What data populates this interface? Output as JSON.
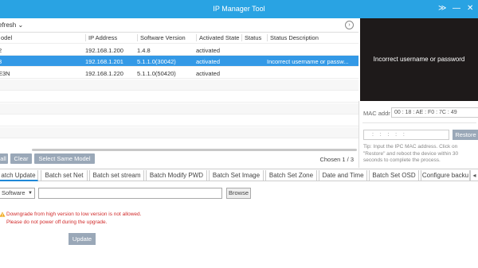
{
  "window": {
    "title": "IP Manager Tool",
    "controls": [
      "≫",
      "—",
      "✕"
    ]
  },
  "toolbar": {
    "refresh_label": "efresh ⌄",
    "toggle_icon": "›"
  },
  "table": {
    "headers": [
      "odel",
      "IP Address",
      "Software Version",
      "Activated State",
      "Status",
      "Status Description"
    ],
    "rows": [
      {
        "model": "2",
        "ip": "192.168.1.200",
        "version": "1.4.8",
        "state": "activated",
        "status": "",
        "desc": ""
      },
      {
        "model": "3",
        "ip": "192.168.1.201",
        "version": "5.1.1.0(30042)",
        "state": "activated",
        "status": "",
        "desc": "Incorrect username or passw..."
      },
      {
        "model": "E3N",
        "ip": "192.168.1.220",
        "version": "5.1.1.0(50420)",
        "state": "activated",
        "status": "",
        "desc": ""
      }
    ]
  },
  "actions": {
    "all_label": "all",
    "clear_label": "Clear",
    "select_same_label": "Select Same Model",
    "chosen": "Chosen 1 / 3"
  },
  "preview": {
    "message": "Incorrect username or password"
  },
  "mac": {
    "label": "MAC addr",
    "value": "00 : 18 : AE : F0 : 7C : 49"
  },
  "restore": {
    "input_value": ":    :    :    :    :",
    "button_label": "Restore",
    "tip": "Tip: Input the IPC MAC address. Click on \"Restore\" and reboot the device within 30 seconds to complete the process."
  },
  "tabs": [
    {
      "label": "atch Update",
      "active": true
    },
    {
      "label": "Batch set Net",
      "active": false
    },
    {
      "label": "Batch set stream",
      "active": false
    },
    {
      "label": "Batch Modify PWD",
      "active": false
    },
    {
      "label": "Batch Set Image",
      "active": false
    },
    {
      "label": "Batch Set Zone",
      "active": false
    },
    {
      "label": "Date and Time",
      "active": false
    },
    {
      "label": "Batch Set OSD",
      "active": false
    },
    {
      "label": "Configure backu",
      "active": false
    }
  ],
  "upgrade": {
    "type_select": "Software",
    "path_value": "",
    "browse_label": "Browse",
    "warning_line1": "Downgrade from high version to low version is not allowed.",
    "warning_line2": "Please do not power off during the upgrade.",
    "update_label": "Update"
  },
  "colors": {
    "titlebar": "#29a3e3",
    "selection": "#3399e6",
    "button": "#9aa8b8",
    "warning": "#d12b2b"
  }
}
